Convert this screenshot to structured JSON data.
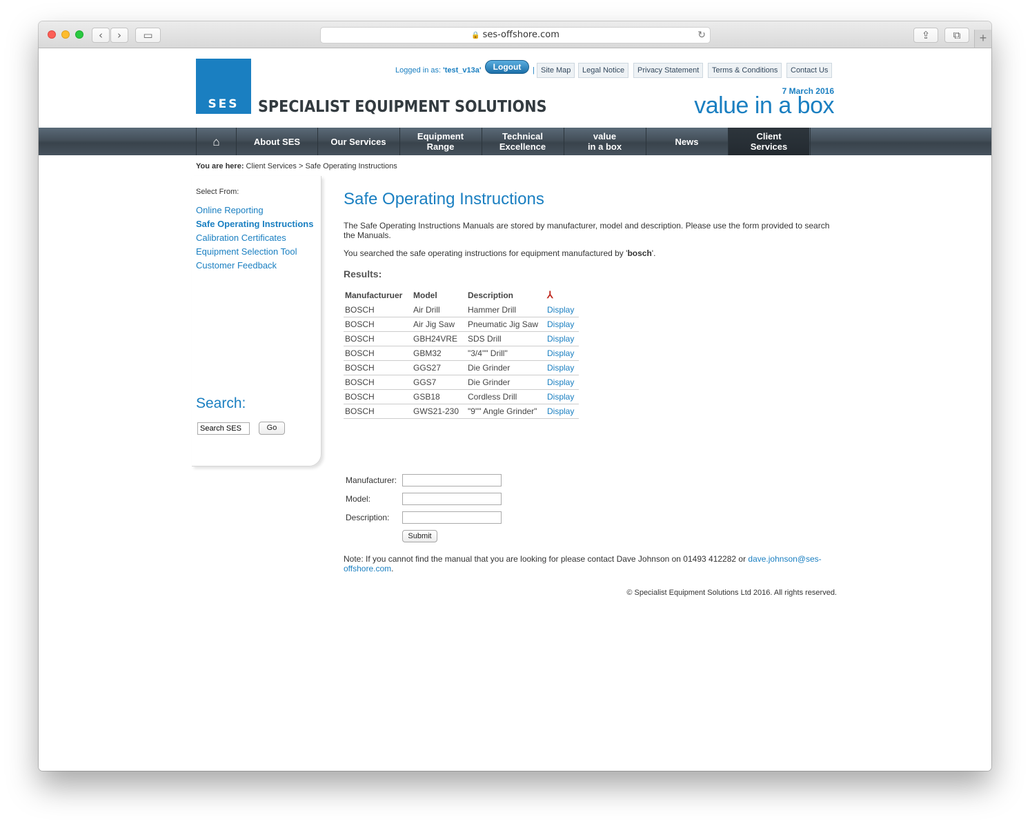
{
  "browser": {
    "url": "ses-offshore.com",
    "back_glyph": "‹",
    "forward_glyph": "›",
    "sidebar_glyph": "▭",
    "share_glyph": "⇪",
    "tabs_glyph": "⧉",
    "new_tab_glyph": "+",
    "lock_glyph": "🔒",
    "reload_glyph": "↻"
  },
  "header": {
    "logo_text": "SES",
    "brand_name": "SPECIALIST EQUIPMENT SOLUTIONS",
    "logged_in_prefix": "Logged in as: ",
    "logged_in_user": "'test_v13a'",
    "logout_label": "Logout",
    "separator": "|",
    "top_links": [
      "Site Map",
      "Legal Notice",
      "Privacy Statement",
      "Terms & Conditions",
      "Contact Us"
    ],
    "date": "7 March 2016",
    "tagline": "value in a box"
  },
  "nav": {
    "home_glyph": "⌂",
    "items": [
      "About SES",
      "Our Services",
      "Equipment\nRange",
      "Technical\nExcellence",
      "value\nin a box",
      "News",
      "Client\nServices"
    ]
  },
  "breadcrumb": {
    "label": "You are here:",
    "path": " Client Services > Safe Operating Instructions"
  },
  "sidebar": {
    "select_from": "Select From:",
    "links": [
      "Online Reporting",
      "Safe Operating Instructions",
      "Calibration Certificates",
      "Equipment Selection Tool",
      "Customer Feedback"
    ],
    "search_title": "Search:",
    "search_value": "Search SES",
    "go_label": "Go"
  },
  "main": {
    "title": "Safe Operating Instructions",
    "intro": "The Safe Operating Instructions Manuals are stored by manufacturer, model and description. Please use the form provided to search the Manuals.",
    "searched_prefix": "You searched the safe operating instructions for equipment manufactured by '",
    "searched_term": "bosch",
    "searched_suffix": "'.",
    "results_heading": "Results:",
    "table": {
      "headers": [
        "Manufacturuer",
        "Model",
        "Description"
      ],
      "pdf_icon_glyph": "⅄",
      "rows": [
        [
          "BOSCH",
          "Air Drill",
          "Hammer Drill",
          "Display"
        ],
        [
          "BOSCH",
          "Air Jig Saw",
          "Pneumatic Jig Saw",
          "Display"
        ],
        [
          "BOSCH",
          "GBH24VRE",
          "SDS Drill",
          "Display"
        ],
        [
          "BOSCH",
          "GBM32",
          "\"3/4\"\" Drill\"",
          "Display"
        ],
        [
          "BOSCH",
          "GGS27",
          "Die Grinder",
          "Display"
        ],
        [
          "BOSCH",
          "GGS7",
          "Die Grinder",
          "Display"
        ],
        [
          "BOSCH",
          "GSB18",
          "Cordless Drill",
          "Display"
        ],
        [
          "BOSCH",
          "GWS21-230",
          "\"9\"\" Angle Grinder\"",
          "Display"
        ]
      ]
    },
    "form": {
      "manufacturer_label": "Manufacturer:",
      "model_label": "Model:",
      "description_label": "Description:",
      "submit_label": "Submit"
    },
    "note_text": "Note: If you cannot find the manual that you are looking for please contact Dave Johnson on 01493 412282 or ",
    "note_email": "dave.johnson@ses-offshore.com",
    "note_end": ".",
    "copyright": "© Specialist Equipment Solutions Ltd 2016. All rights reserved."
  },
  "colors": {
    "brand_blue": "#1a7fc1",
    "nav_dark": "#39434c"
  }
}
